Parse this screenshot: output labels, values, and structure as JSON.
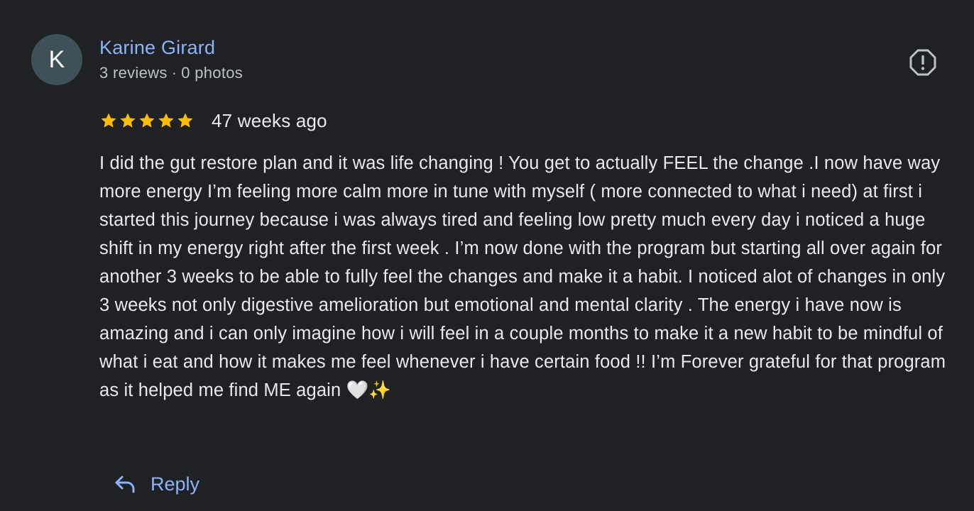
{
  "review": {
    "avatar_letter": "K",
    "author_name": "Karine Girard",
    "review_count": "3 reviews",
    "separator": "·",
    "photo_count": "0 photos",
    "rating": 5,
    "rating_max": 5,
    "time_ago": "47 weeks ago",
    "text": "I did the gut restore plan and it was life changing ! You get to actually FEEL the change .I now have way more energy I’m feeling more calm more in tune with myself ( more connected to what i need) at first i started this journey because i was always tired and feeling low pretty much every day i noticed a huge shift in my energy right after the first week . I’m now done with the program but starting all over again for another 3 weeks to be able to fully feel the changes and make it a habit. I noticed alot of changes in only 3 weeks not only digestive amelioration but emotional and mental clarity . The energy i have now is amazing and i can only imagine how i will feel in a couple months to make it a new habit to be mindful of what i eat and how it makes me feel whenever i have certain food !! I’m Forever grateful for that program as it helped me find ME again 🤍✨"
  },
  "actions": {
    "reply_label": "Reply",
    "reply_icon": "reply-arrow-icon",
    "report_icon": "report-icon"
  },
  "colors": {
    "background": "#202124",
    "link": "#8ab4f8",
    "star": "#fbbc04",
    "avatar_bg": "#3f5158",
    "secondary_text": "#bdc1c6",
    "primary_text": "#e8eaed"
  }
}
